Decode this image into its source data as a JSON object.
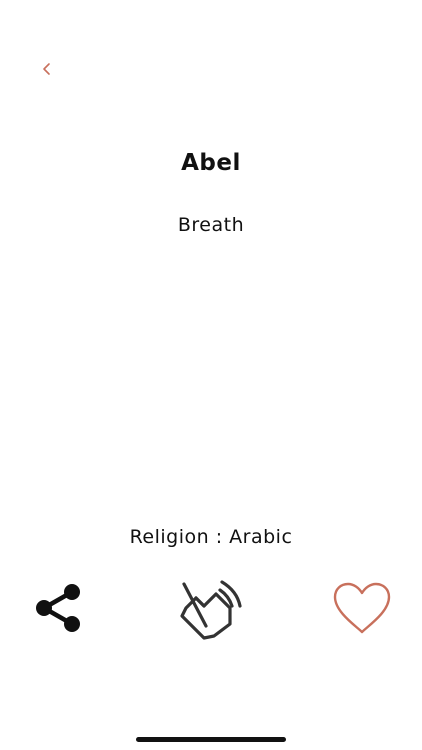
{
  "header": {
    "back_icon": "chevron-left-icon"
  },
  "name": {
    "title": "Abel",
    "meaning": "Breath"
  },
  "details": {
    "religion_text": "Religion : Arabic"
  },
  "actions": {
    "share_icon": "share-icon",
    "sound_icon": "speaker-icon",
    "favorite_icon": "heart-icon"
  },
  "colors": {
    "accent": "#c8705c",
    "text": "#111111",
    "speaker_outline": "#333333",
    "background": "#ffffff"
  }
}
